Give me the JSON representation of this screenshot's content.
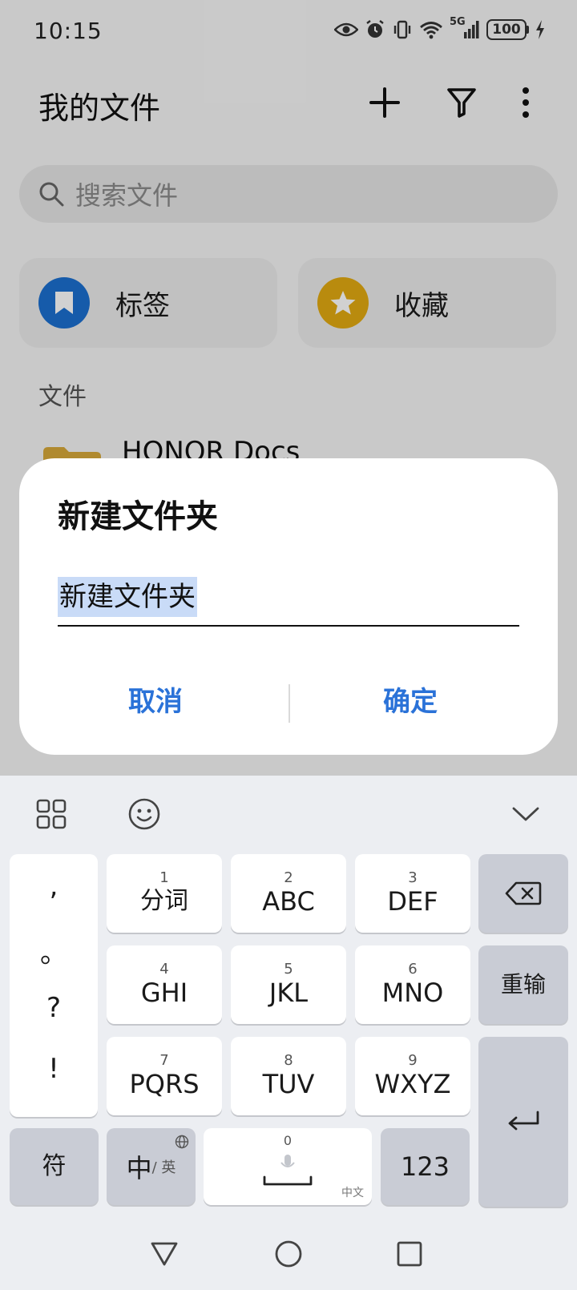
{
  "status_bar": {
    "time": "10:15",
    "network": "5G",
    "battery": "100"
  },
  "header": {
    "title": "我的文件",
    "add_icon": "plus-icon",
    "filter_icon": "filter-icon",
    "more_icon": "more-vert-icon"
  },
  "search": {
    "placeholder": "搜索文件"
  },
  "quick_access": [
    {
      "label": "标签",
      "icon": "bookmark-icon",
      "color": "#1b6fd0"
    },
    {
      "label": "收藏",
      "icon": "star-icon",
      "color": "#e2aa12"
    }
  ],
  "files": {
    "section_title": "文件",
    "items": [
      {
        "name": "HONOR Docs",
        "icon": "folder-icon"
      }
    ]
  },
  "dialog": {
    "title": "新建文件夹",
    "input_value": "新建文件夹",
    "cancel_label": "取消",
    "confirm_label": "确定",
    "accent_color": "#2a72d8"
  },
  "keyboard": {
    "punctuation": [
      ",",
      "。",
      "?",
      "!"
    ],
    "keys": [
      {
        "num": "1",
        "label": "分词"
      },
      {
        "num": "2",
        "label": "ABC"
      },
      {
        "num": "3",
        "label": "DEF"
      },
      {
        "num": "4",
        "label": "GHI"
      },
      {
        "num": "5",
        "label": "JKL"
      },
      {
        "num": "6",
        "label": "MNO"
      },
      {
        "num": "7",
        "label": "PQRS"
      },
      {
        "num": "8",
        "label": "TUV"
      },
      {
        "num": "9",
        "label": "WXYZ"
      }
    ],
    "reinput_label": "重输",
    "symbol_label": "符",
    "lang_main": "中",
    "lang_sub": "/ 英",
    "space_num": "0",
    "space_sub": "中文",
    "numeric_label": "123"
  }
}
